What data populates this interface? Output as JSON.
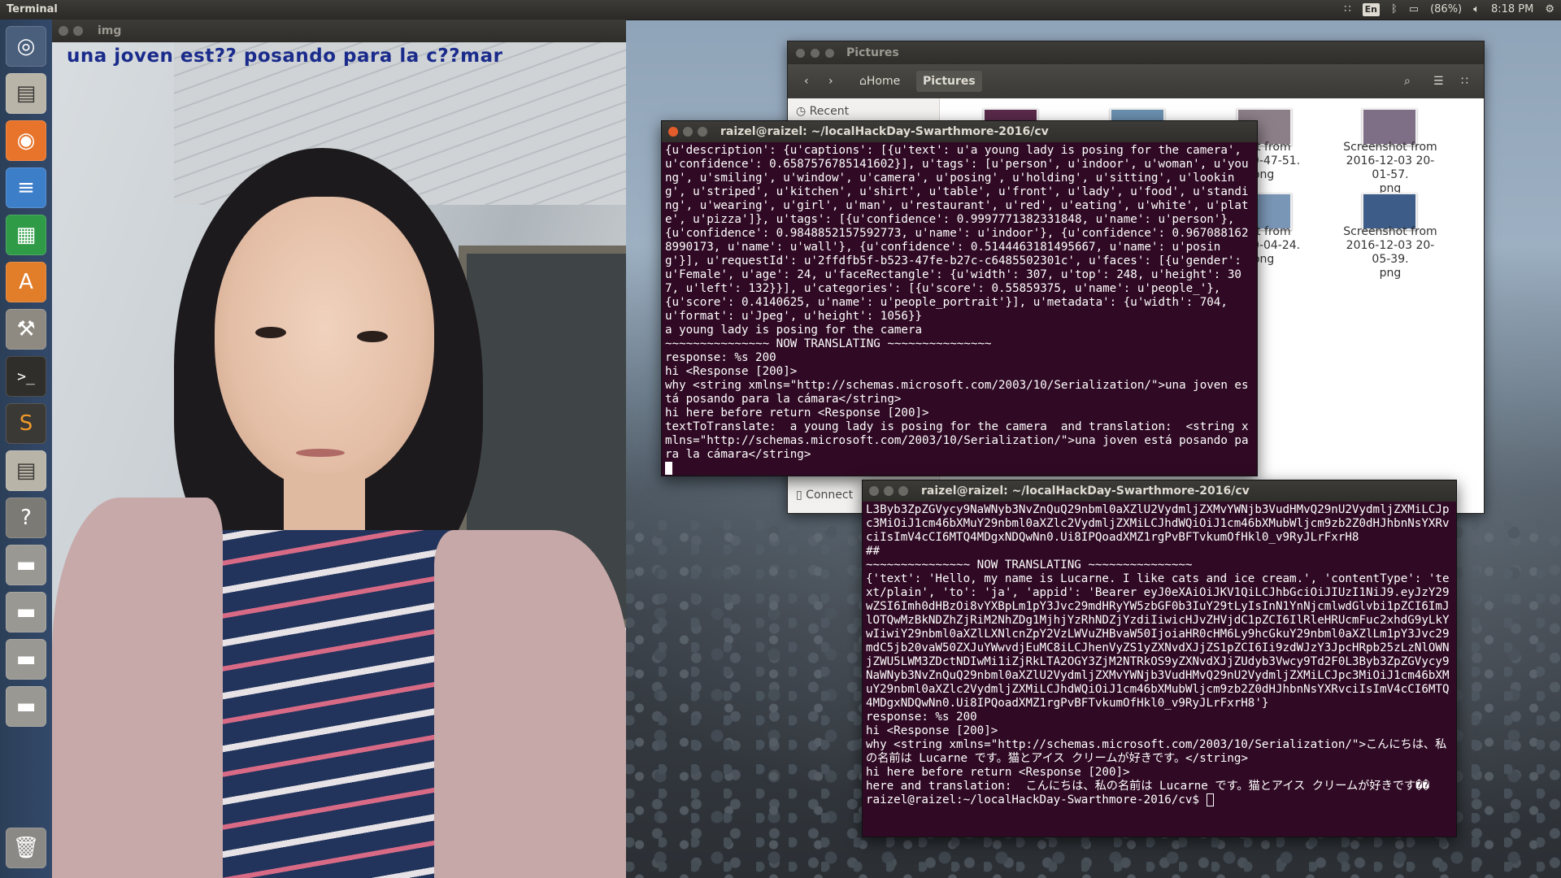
{
  "top_panel": {
    "app_title": "Terminal",
    "keyboard": "En",
    "battery": "(86%)",
    "clock": "8:18 PM",
    "icons": [
      "wifi-icon",
      "keyboard-icon",
      "bluetooth-icon",
      "battery-icon",
      "volume-icon",
      "gear-icon"
    ]
  },
  "launcher": {
    "items": [
      "ubuntu-dash-icon",
      "files-icon",
      "firefox-icon",
      "writer-icon",
      "calc-icon",
      "software-center-icon",
      "settings-icon",
      "terminal-icon",
      "sublime-icon",
      "files-icon",
      "help-icon",
      "drive-icon",
      "drive-icon",
      "drive-icon",
      "drive-icon",
      "trash-icon"
    ]
  },
  "img_window": {
    "title": "img",
    "caption": "una joven est?? posando para la c??mar"
  },
  "files_window": {
    "title": "Pictures",
    "path_home": "Home",
    "path_current": "Pictures",
    "sidebar_recent": "Recent",
    "sidebar_connect": "Connect",
    "items": [
      {
        "label": "shot from\n03 19-47-51.\npng"
      },
      {
        "label": "Screenshot from\n2016-12-03 20-01-57.\npng"
      },
      {
        "label": "shot from\n03 20-04-24.\npng"
      },
      {
        "label": "Screenshot from\n2016-12-03 20-05-39.\npng"
      }
    ]
  },
  "terminal1": {
    "title": "raizel@raizel: ~/localHackDay-Swarthmore-2016/cv",
    "output": "{u'description': {u'captions': [{u'text': u'a young lady is posing for the camera', u'confidence': 0.6587576785141602}], u'tags': [u'person', u'indoor', u'woman', u'young', u'smiling', u'window', u'camera', u'posing', u'holding', u'sitting', u'looking', u'striped', u'kitchen', u'shirt', u'table', u'front', u'lady', u'food', u'standing', u'wearing', u'girl', u'man', u'restaurant', u'red', u'eating', u'white', u'plate', u'pizza']}, u'tags': [{u'confidence': 0.9997771382331848, u'name': u'person'}, {u'confidence': 0.9848852157592773, u'name': u'indoor'}, {u'confidence': 0.9670881628990173, u'name': u'wall'}, {u'confidence': 0.5144463181495667, u'name': u'posing'}], u'requestId': u'2ffdfb5f-b523-47fe-b27c-c6485502301c', u'faces': [{u'gender': u'Female', u'age': 24, u'faceRectangle': {u'width': 307, u'top': 248, u'height': 307, u'left': 132}}], u'categories': [{u'score': 0.55859375, u'name': u'people_'}, {u'score': 0.4140625, u'name': u'people_portrait'}], u'metadata': {u'width': 704, u'format': u'Jpeg', u'height': 1056}}\na young lady is posing for the camera\n~~~~~~~~~~~~~~~ NOW TRANSLATING ~~~~~~~~~~~~~~~\nresponse: %s 200\nhi <Response [200]>\nwhy <string xmlns=\"http://schemas.microsoft.com/2003/10/Serialization/\">una joven está posando para la cámara</string>\nhi here before return <Response [200]>\ntextToTranslate:  a young lady is posing for the camera  and translation:  <string xmlns=\"http://schemas.microsoft.com/2003/10/Serialization/\">una joven está posando para la cámara</string>\n"
  },
  "terminal2": {
    "title": "raizel@raizel: ~/localHackDay-Swarthmore-2016/cv",
    "output": "L3Byb3ZpZGVycy9NaWNyb3NvZnQuQ29nbml0aXZlU2VydmljZXMvYWNjb3VudHMvQ29nU2VydmljZXMiLCJpc3MiOiJ1cm46bXMuY29nbml0aXZlc2VydmljZXMiLCJhdWQiOiJ1cm46bXMubWljcm9zb2Z0dHJhbnNsYXRvciIsImV4cCI6MTQ4MDgxNDQwNn0.Ui8IPQoadXMZ1rgPvBFTvkumOfHkl0_v9RyJLrFxrH8\n##\n~~~~~~~~~~~~~~~ NOW TRANSLATING ~~~~~~~~~~~~~~~\n{'text': 'Hello, my name is Lucarne. I like cats and ice cream.', 'contentType': 'text/plain', 'to': 'ja', 'appid': 'Bearer eyJ0eXAiOiJKV1QiLCJhbGciOiJIUzI1NiJ9.eyJzY29wZSI6Imh0dHBzOi8vYXBpLm1pY3Jvc29mdHRyYW5zbGF0b3IuY29tLyIsInN1YnNjcmlwdGlvbi1pZCI6ImJlOTQwMzBkNDZhZjRiM2NhZDg1MjhjYzRhNDZjYzdiIiwicHJvZHVjdC1pZCI6IlRleHRUcmFuc2xhdG9yLkYwIiwiY29nbml0aXZlLXNlcnZpY2VzLWVuZHBvaW50IjoiaHR0cHM6Ly9hcGkuY29nbml0aXZlLm1pY3Jvc29mdC5jb20vaW50ZXJuYWwvdjEuMC8iLCJhenVyZS1yZXNvdXJjZS1pZCI6Ii9zdWJzY3JpcHRpb25zLzNlOWNjZWU5LWM3ZDctNDIwMi1iZjRkLTA2OGY3ZjM2NTRkOS9yZXNvdXJjZUdyb3Vwcy9Td2F0L3Byb3ZpZGVycy9NaWNyb3NvZnQuQ29nbml0aXZlU2VydmljZXMvYWNjb3VudHMvQ29nU2VydmljZXMiLCJpc3MiOiJ1cm46bXMuY29nbml0aXZlc2VydmljZXMiLCJhdWQiOiJ1cm46bXMubWljcm9zb2Z0dHJhbnNsYXRvciIsImV4cCI6MTQ4MDgxNDQwNn0.Ui8IPQoadXMZ1rgPvBFTvkumOfHkl0_v9RyJLrFxrH8'}\nresponse: %s 200\nhi <Response [200]>\nwhy <string xmlns=\"http://schemas.microsoft.com/2003/10/Serialization/\">こんにちは、私の名前は Lucarne です。猫とアイス クリームが好きです。</string>\nhi here before return <Response [200]>\nhere and translation:  こんにちは、私の名前は Lucarne です。猫とアイス クリームが好きです��",
    "prompt": "raizel@raizel:~/localHackDay-Swarthmore-2016/cv$ "
  }
}
